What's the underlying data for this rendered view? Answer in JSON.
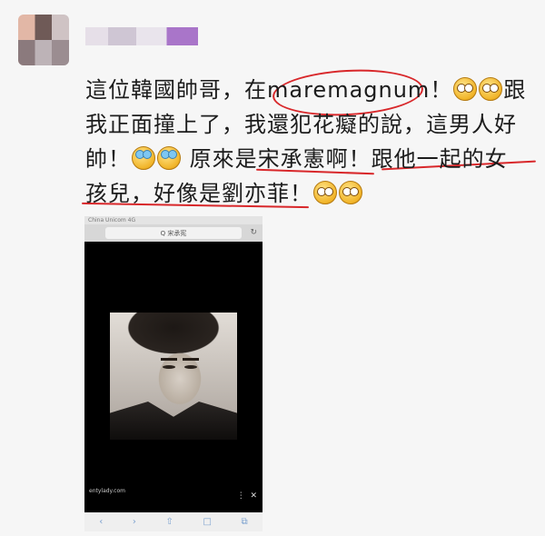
{
  "post": {
    "line1": {
      "a": "這位韓國帥哥，在",
      "b": "maremagnum",
      "c": "！",
      "d": "跟"
    },
    "line2": "我正面撞上了，我還犯花癡的說，這男人好",
    "line3": {
      "a": "帥！",
      "b": "原來是宋承憲啊！",
      "c": "跟他一起的女"
    },
    "line4": "孩兒，好像是劉亦菲！"
  },
  "emoji": [
    "shocked-emoji",
    "shocked-emoji",
    "laughing-crying-emoji",
    "laughing-crying-emoji",
    "shocked-emoji",
    "shocked-emoji"
  ],
  "phone": {
    "status": "China Unicom 4G",
    "url": "Q 宋承宪",
    "caption1": "entylady.com",
    "caption2": "",
    "reload_icon": "↻",
    "menu_icon": "⋮",
    "close_icon": "✕",
    "nav": [
      "‹",
      "›",
      "⇧",
      "□",
      "⧉"
    ]
  },
  "colors": {
    "annotation_red": "#d8272a"
  }
}
